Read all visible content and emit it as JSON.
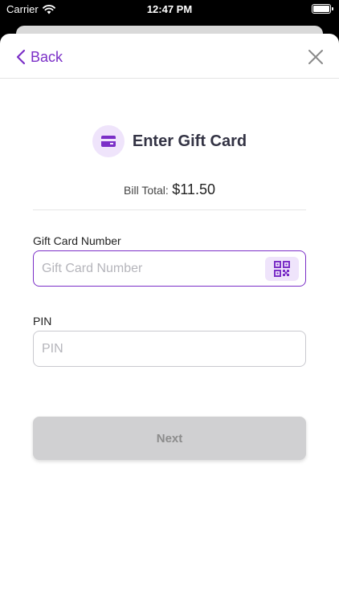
{
  "status_bar": {
    "carrier": "Carrier",
    "time": "12:47 PM"
  },
  "nav": {
    "back_label": "Back"
  },
  "header": {
    "title": "Enter Gift Card",
    "icon": "credit-card-icon"
  },
  "bill": {
    "label": "Bill Total:",
    "amount": "$11.50"
  },
  "gift_card_number": {
    "label": "Gift Card Number",
    "placeholder": "Gift Card Number",
    "value": ""
  },
  "pin": {
    "label": "PIN",
    "placeholder": "PIN",
    "value": ""
  },
  "next_button": {
    "label": "Next"
  },
  "colors": {
    "accent": "#7b2fc7",
    "accent_light": "#efe4fb",
    "disabled_button": "#d0d0d2",
    "disabled_text": "#8c8c8c"
  }
}
